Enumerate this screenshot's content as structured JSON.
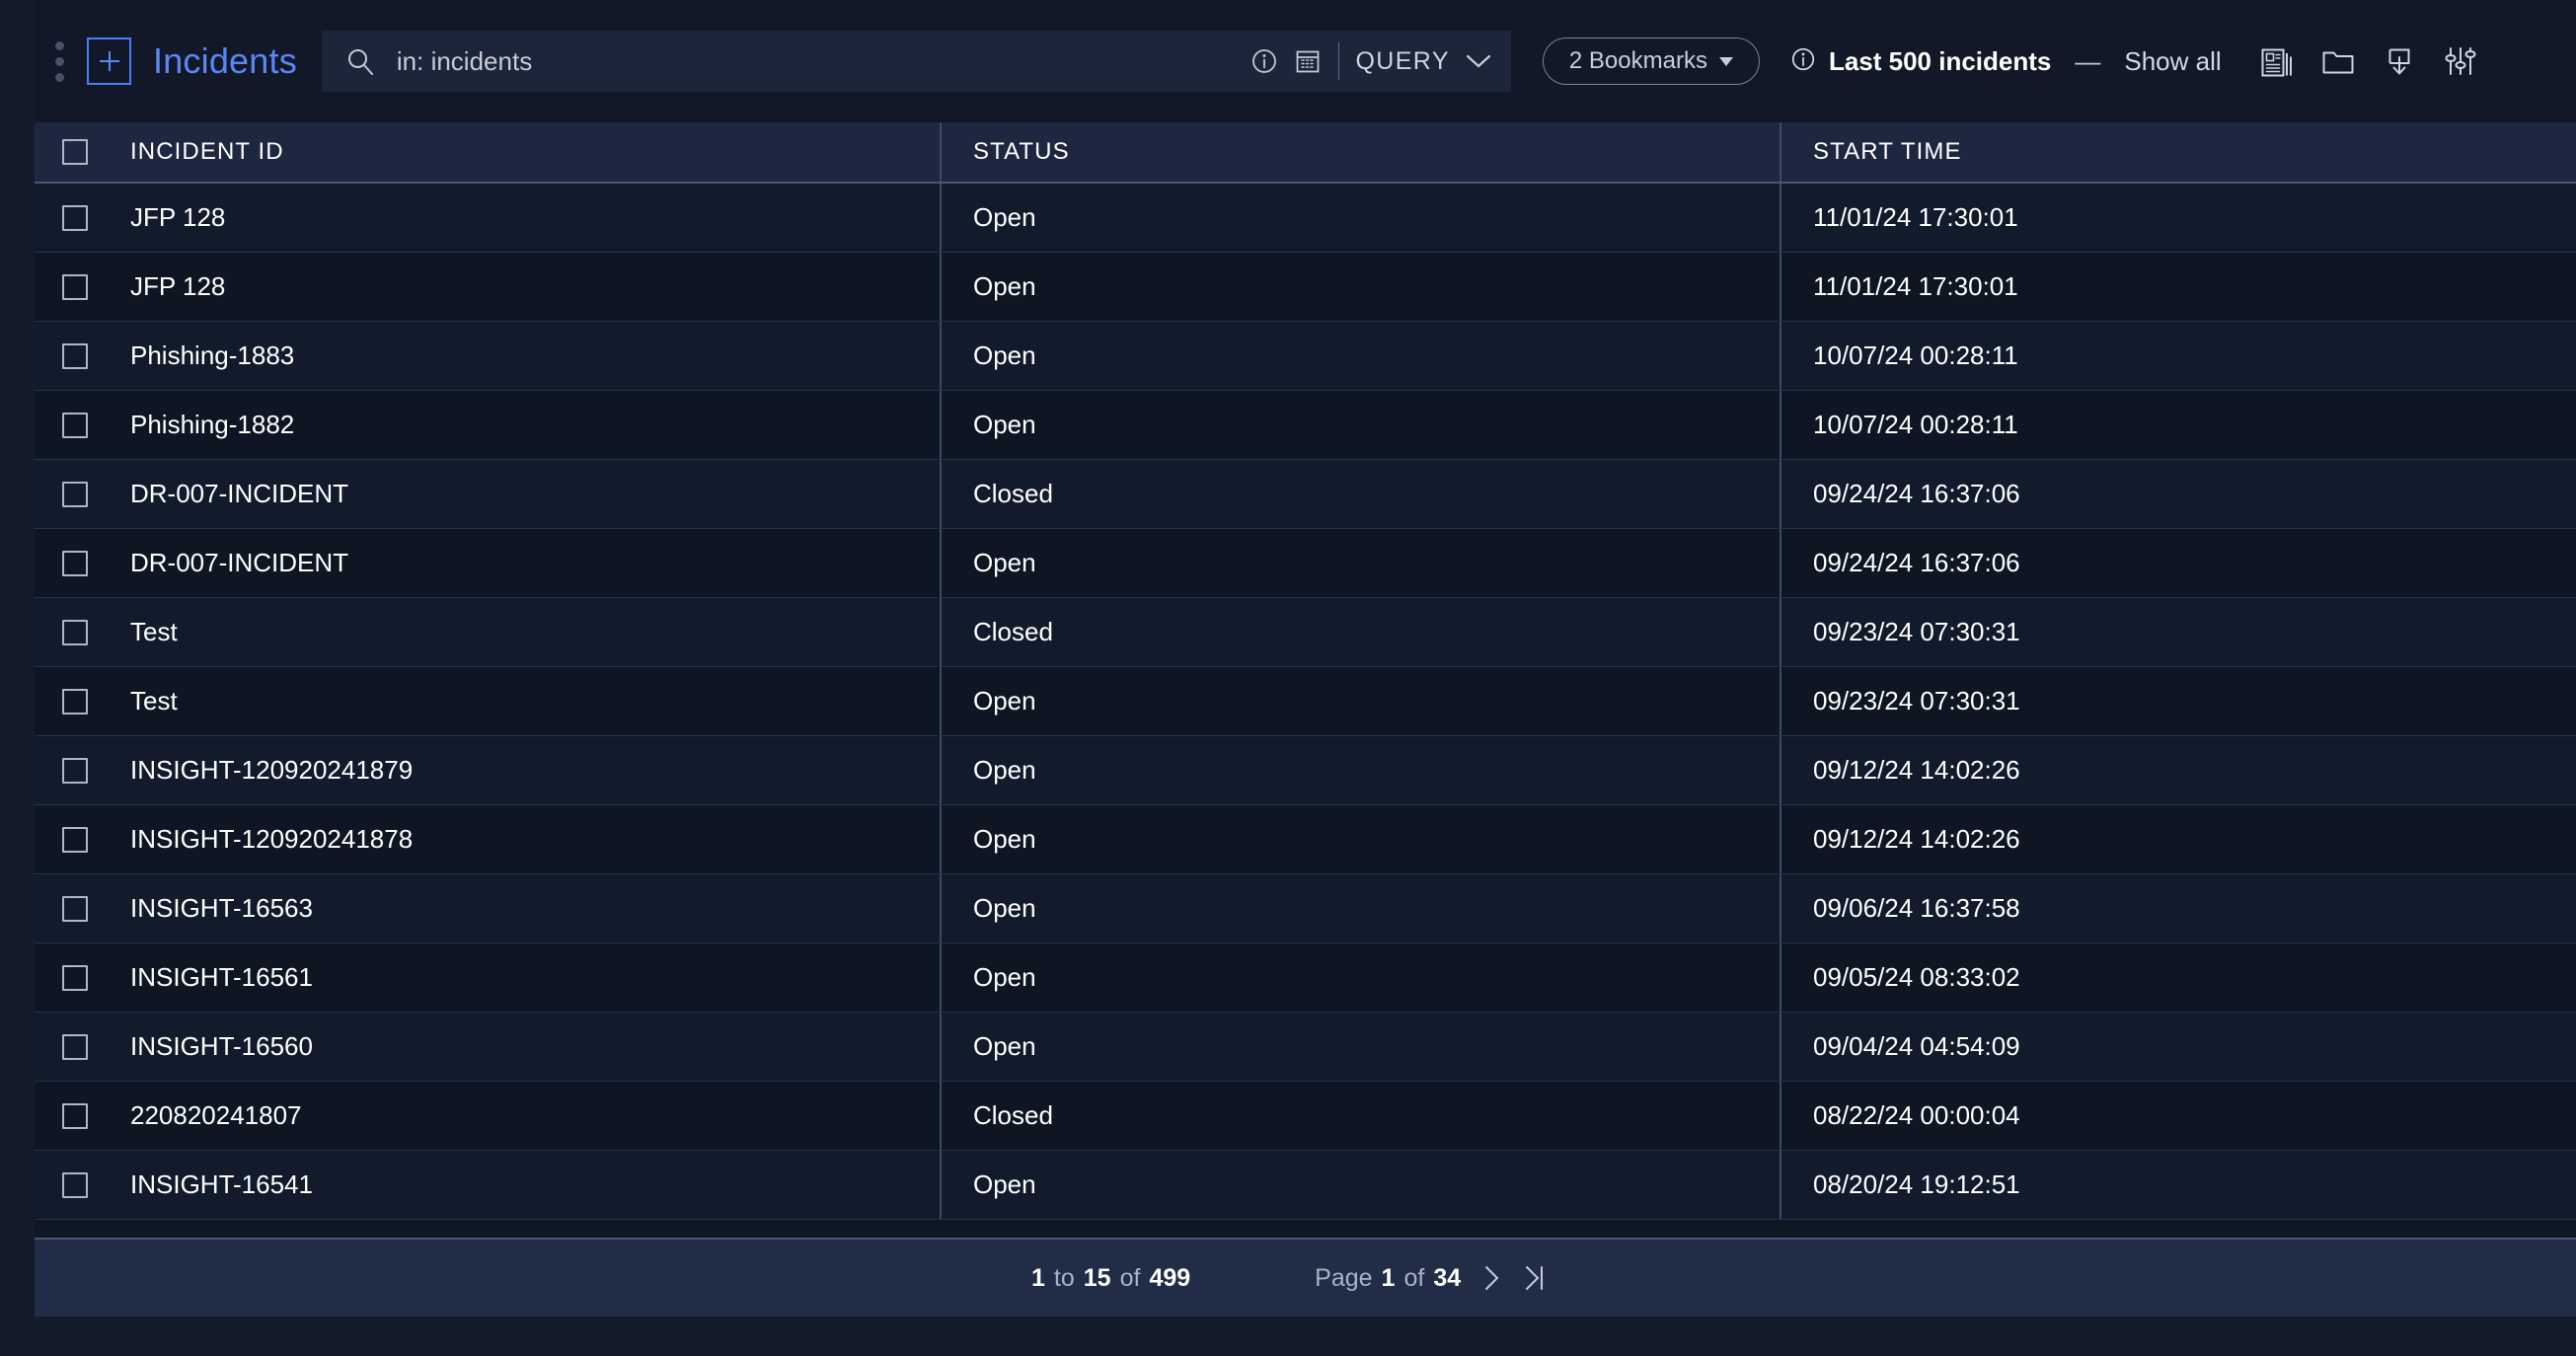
{
  "toolbar": {
    "menu_icon": "kebab-menu-icon",
    "add_label": "+",
    "title": "Incidents",
    "search": {
      "icon": "search-icon",
      "value": "in: incidents",
      "placeholder": "in: incidents"
    },
    "info_icon": "info-circle-icon",
    "calendar_icon": "calendar-icon",
    "query_label": "QUERY",
    "query_chevron": "chevron-down-icon",
    "bookmarks_label": "2 Bookmarks",
    "last_info_icon": "info-circle-icon",
    "last_label": "Last 500 incidents",
    "dash": "—",
    "show_all_label": "Show all",
    "icons": [
      {
        "name": "pages-stack-icon"
      },
      {
        "name": "folder-icon"
      },
      {
        "name": "export-download-icon"
      },
      {
        "name": "sliders-settings-icon"
      }
    ]
  },
  "table": {
    "columns": [
      "INCIDENT ID",
      "STATUS",
      "START TIME"
    ],
    "rows": [
      {
        "id": "JFP 128",
        "status": "Open",
        "start_time": "11/01/24 17:30:01"
      },
      {
        "id": "JFP 128",
        "status": "Open",
        "start_time": "11/01/24 17:30:01"
      },
      {
        "id": "Phishing-1883",
        "status": "Open",
        "start_time": "10/07/24 00:28:11"
      },
      {
        "id": "Phishing-1882",
        "status": "Open",
        "start_time": "10/07/24 00:28:11"
      },
      {
        "id": "DR-007-INCIDENT",
        "status": "Closed",
        "start_time": "09/24/24 16:37:06"
      },
      {
        "id": "DR-007-INCIDENT",
        "status": "Open",
        "start_time": "09/24/24 16:37:06"
      },
      {
        "id": "Test",
        "status": "Closed",
        "start_time": "09/23/24 07:30:31"
      },
      {
        "id": "Test",
        "status": "Open",
        "start_time": "09/23/24 07:30:31"
      },
      {
        "id": "INSIGHT-120920241879",
        "status": "Open",
        "start_time": "09/12/24 14:02:26"
      },
      {
        "id": "INSIGHT-120920241878",
        "status": "Open",
        "start_time": "09/12/24 14:02:26"
      },
      {
        "id": "INSIGHT-16563",
        "status": "Open",
        "start_time": "09/06/24 16:37:58"
      },
      {
        "id": "INSIGHT-16561",
        "status": "Open",
        "start_time": "09/05/24 08:33:02"
      },
      {
        "id": "INSIGHT-16560",
        "status": "Open",
        "start_time": "09/04/24 04:54:09"
      },
      {
        "id": "220820241807",
        "status": "Closed",
        "start_time": "08/22/24 00:00:04"
      },
      {
        "id": "INSIGHT-16541",
        "status": "Open",
        "start_time": "08/20/24 19:12:51"
      }
    ]
  },
  "footer": {
    "range_from": "1",
    "range_to_word": "to",
    "range_to": "15",
    "range_of_word": "of",
    "range_total": "499",
    "page_word": "Page",
    "page_current": "1",
    "page_of_word": "of",
    "page_total": "34",
    "next_icon": "chevron-right-icon",
    "last_icon": "chevron-last-icon"
  },
  "colors": {
    "accent_blue": "#5b86f5",
    "toolbar_bg": "#121827",
    "table_bg": "#0f1624",
    "header_bg": "#1e2740",
    "footer_bg": "#212c46",
    "text_primary": "#ffffff",
    "text_muted": "#aab3c4"
  }
}
